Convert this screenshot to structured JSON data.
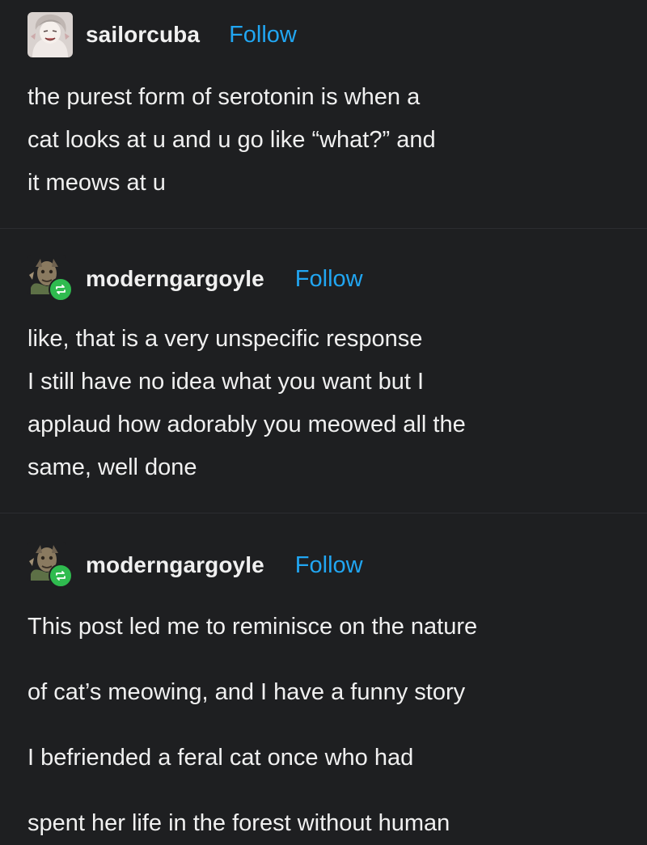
{
  "posts": [
    {
      "username": "sailorcuba",
      "follow_label": "Follow",
      "avatar_icon": "anime-character-avatar-icon",
      "lines": [
        "the purest form of serotonin is when a",
        "cat looks at u and u go like “what?” and",
        "it meows at u"
      ]
    },
    {
      "username": "moderngargoyle",
      "follow_label": "Follow",
      "avatar_icon": "gargoyle-avatar-icon",
      "badge_icon": "reblog-icon",
      "lines": [
        "like, that is a very unspecific response",
        "I still have no idea what you want but I",
        "applaud how adorably you meowed all the",
        "same, well done"
      ]
    },
    {
      "username": "moderngargoyle",
      "follow_label": "Follow",
      "avatar_icon": "gargoyle-avatar-icon",
      "badge_icon": "reblog-icon",
      "paragraph1": [
        "This post led me to reminisce on the nature",
        "of cat’s meowing, and I have a funny story"
      ],
      "paragraph2": [
        "I befriended a feral cat once who had",
        "spent her life in the forest without human"
      ]
    }
  ],
  "colors": {
    "background": "#1e1f21",
    "text": "#f0f0f0",
    "follow": "#21a6f2",
    "reblog_badge": "#2fbb4f"
  }
}
